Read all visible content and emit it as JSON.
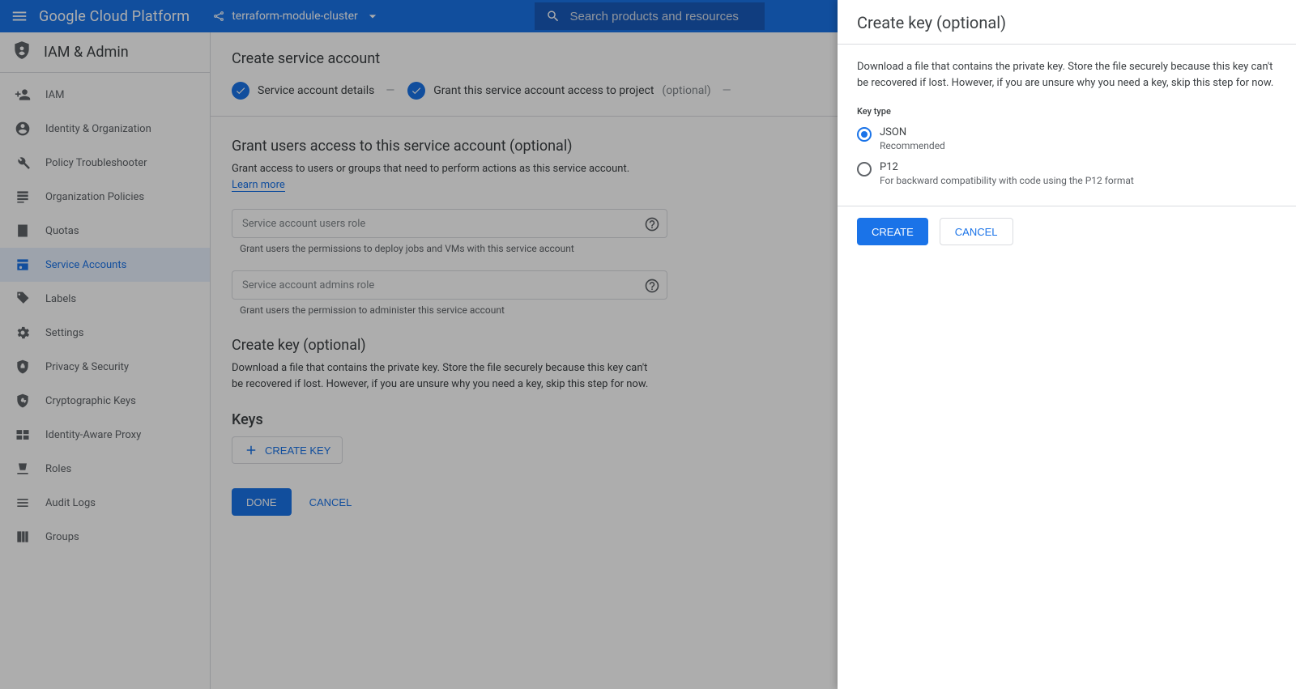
{
  "topbar": {
    "logo": "Google Cloud Platform",
    "project": "terraform-module-cluster",
    "search_placeholder": "Search products and resources"
  },
  "sidebar": {
    "title": "IAM & Admin",
    "items": [
      {
        "label": "IAM",
        "icon": "people-add"
      },
      {
        "label": "Identity & Organization",
        "icon": "person-circle"
      },
      {
        "label": "Policy Troubleshooter",
        "icon": "wrench"
      },
      {
        "label": "Organization Policies",
        "icon": "list-doc"
      },
      {
        "label": "Quotas",
        "icon": "quota-doc"
      },
      {
        "label": "Service Accounts",
        "icon": "key-badge",
        "active": true
      },
      {
        "label": "Labels",
        "icon": "tag"
      },
      {
        "label": "Settings",
        "icon": "gear"
      },
      {
        "label": "Privacy & Security",
        "icon": "shield-lock"
      },
      {
        "label": "Cryptographic Keys",
        "icon": "shield-key"
      },
      {
        "label": "Identity-Aware Proxy",
        "icon": "iap"
      },
      {
        "label": "Roles",
        "icon": "roles"
      },
      {
        "label": "Audit Logs",
        "icon": "audit"
      },
      {
        "label": "Groups",
        "icon": "groups"
      }
    ]
  },
  "page": {
    "title": "Create service account",
    "steps": {
      "one": "Service account details",
      "two": "Grant this service account access to project",
      "two_opt": " (optional)"
    },
    "grant_section": {
      "heading": "Grant users access to this service account (optional)",
      "desc": "Grant access to users or groups that need to perform actions as this service account.",
      "learn": "Learn more",
      "users_role_label": "Service account users role",
      "users_role_hint": "Grant users the permissions to deploy jobs and VMs with this service account",
      "admins_role_label": "Service account admins role",
      "admins_role_hint": "Grant users the permission to administer this service account"
    },
    "key_section": {
      "heading": "Create key (optional)",
      "desc": "Download a file that contains the private key. Store the file securely because this key can't be recovered if lost. However, if you are unsure why you need a key, skip this step for now.",
      "keys_h": "Keys",
      "create_key": "CREATE KEY"
    },
    "actions": {
      "done": "DONE",
      "cancel": "CANCEL"
    }
  },
  "dialog": {
    "title": "Create key (optional)",
    "desc": "Download a file that contains the private key. Store the file securely because this key can't be recovered if lost. However, if you are unsure why you need a key, skip this step for now.",
    "key_type_label": "Key type",
    "options": {
      "json": {
        "name": "JSON",
        "sub": "Recommended",
        "selected": true
      },
      "p12": {
        "name": "P12",
        "sub": "For backward compatibility with code using the P12 format",
        "selected": false
      }
    },
    "actions": {
      "create": "CREATE",
      "cancel": "CANCEL"
    }
  }
}
